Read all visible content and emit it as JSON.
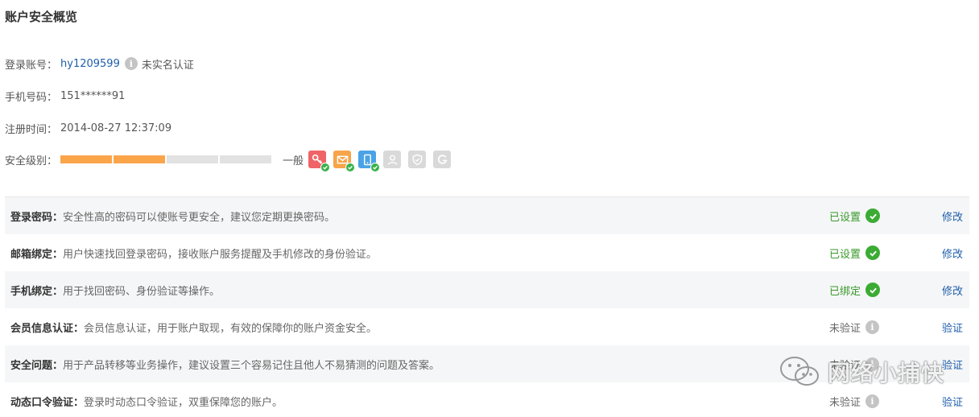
{
  "page_title": "账户安全概览",
  "account": {
    "label": "登录账号：",
    "value": "hy1209599",
    "info_icon": "i",
    "status": "未实名认证"
  },
  "phone": {
    "label": "手机号码：",
    "value": "151******91"
  },
  "register": {
    "label": "注册时间：",
    "value": "2014-08-27 12:37:09"
  },
  "security_level": {
    "label": "安全级别：",
    "segments_total": 4,
    "segments_filled": 2,
    "level_text": "一般",
    "badges": [
      {
        "icon": "key-icon",
        "active": true
      },
      {
        "icon": "mail-icon",
        "active": true
      },
      {
        "icon": "phone-icon",
        "active": true
      },
      {
        "icon": "user-icon",
        "active": false
      },
      {
        "icon": "shield-icon",
        "active": false
      },
      {
        "icon": "g-icon",
        "active": false
      }
    ]
  },
  "items": [
    {
      "title": "登录密码：",
      "desc": "安全性高的密码可以使账号更安全，建议您定期更换密码。",
      "status": "已设置",
      "status_type": "ok",
      "action": "修改"
    },
    {
      "title": "邮箱绑定：",
      "desc": "用户快速找回登录密码，接收账户服务提醒及手机修改的身份验证。",
      "status": "已设置",
      "status_type": "ok",
      "action": "修改"
    },
    {
      "title": "手机绑定：",
      "desc": "用于找回密码、身份验证等操作。",
      "status": "已绑定",
      "status_type": "ok",
      "action": "修改"
    },
    {
      "title": "会员信息认证：",
      "desc": "会员信息认证，用于账户取现，有效的保障你的账户资金安全。",
      "status": "未验证",
      "status_type": "no",
      "action": "验证"
    },
    {
      "title": "安全问题：",
      "desc": "用于产品转移等业务操作，建议设置三个容易记住且他人不易猜测的问题及答案。",
      "status": "未验证",
      "status_type": "no",
      "action": "验证"
    },
    {
      "title": "动态口令验证：",
      "desc": "登录时动态口令验证，双重保障您的账户。",
      "status": "未验证",
      "status_type": "no",
      "action": "验证"
    }
  ],
  "watermark": {
    "text": "网络小捕快"
  },
  "colors": {
    "accent_link": "#1e5eac",
    "bar_fill": "#fba54b",
    "ok_green": "#3cab34"
  }
}
